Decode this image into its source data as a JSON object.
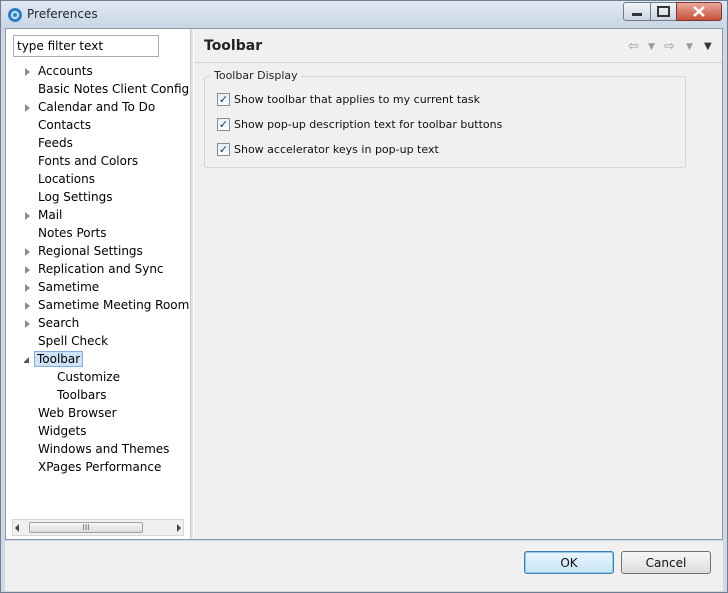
{
  "window": {
    "title": "Preferences",
    "colors": {
      "titlebar": "#cfd9e6",
      "selection": "#cfe3f8",
      "close_button": "#c7503a"
    },
    "icons": [
      "app-icon",
      "minimize-icon",
      "maximize-icon",
      "close-icon"
    ]
  },
  "sidebar": {
    "filter_value": "type filter text",
    "items": [
      {
        "label": "Accounts",
        "expandable": true
      },
      {
        "label": "Basic Notes Client Configura",
        "expandable": false
      },
      {
        "label": "Calendar and To Do",
        "expandable": true
      },
      {
        "label": "Contacts",
        "expandable": false
      },
      {
        "label": "Feeds",
        "expandable": false
      },
      {
        "label": "Fonts and Colors",
        "expandable": false
      },
      {
        "label": "Locations",
        "expandable": false
      },
      {
        "label": "Log Settings",
        "expandable": false
      },
      {
        "label": "Mail",
        "expandable": true
      },
      {
        "label": "Notes Ports",
        "expandable": false
      },
      {
        "label": "Regional Settings",
        "expandable": true
      },
      {
        "label": "Replication and Sync",
        "expandable": true
      },
      {
        "label": "Sametime",
        "expandable": true
      },
      {
        "label": "Sametime Meeting Rooms",
        "expandable": true
      },
      {
        "label": "Search",
        "expandable": true
      },
      {
        "label": "Spell Check",
        "expandable": false
      },
      {
        "label": "Toolbar",
        "expandable": true,
        "expanded": true,
        "selected": true
      },
      {
        "label": "Customize",
        "child": true
      },
      {
        "label": "Toolbars",
        "child": true
      },
      {
        "label": "Web Browser",
        "expandable": false
      },
      {
        "label": "Widgets",
        "expandable": false
      },
      {
        "label": "Windows and Themes",
        "expandable": false
      },
      {
        "label": "XPages Performance",
        "expandable": false
      }
    ],
    "scroll_thumb": "III"
  },
  "page": {
    "title": "Toolbar",
    "icons": [
      "back-arrow-icon",
      "back-menu-icon",
      "forward-arrow-icon",
      "forward-menu-icon",
      "view-menu-icon"
    ],
    "group": {
      "label": "Toolbar Display",
      "options": [
        {
          "label": "Show toolbar that applies to my current task",
          "checked": true
        },
        {
          "label": "Show pop-up description text for toolbar buttons",
          "checked": true
        },
        {
          "label": "Show accelerator keys in pop-up text",
          "checked": true
        }
      ]
    }
  },
  "footer": {
    "ok_label": "OK",
    "cancel_label": "Cancel"
  }
}
